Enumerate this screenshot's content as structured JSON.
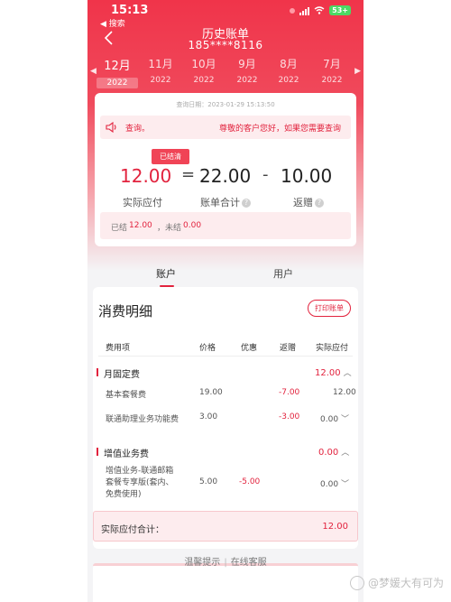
{
  "status_bar": {
    "time": "15:13",
    "back_app": "◀ 搜索",
    "battery": "53+"
  },
  "header": {
    "title": "历史账单",
    "phone": "185****8116"
  },
  "months": [
    {
      "month": "12月",
      "year": "2022",
      "active": true
    },
    {
      "month": "11月",
      "year": "2022"
    },
    {
      "month": "10月",
      "year": "2022"
    },
    {
      "month": "9月",
      "year": "2022"
    },
    {
      "month": "8月",
      "year": "2022"
    },
    {
      "month": "7月",
      "year": "2022"
    }
  ],
  "summary": {
    "query_date": "查询日期：2023-01-29 15:13:50",
    "notice_left": "查询。",
    "notice_right": "尊敬的客户您好，如果您需要查询",
    "status_tag": "已结清",
    "payable": "12.00",
    "op_eq": "=",
    "total": "22.00",
    "op_minus": "-",
    "rebate": "10.00",
    "payable_label": "实际应付",
    "total_label": "账单合计",
    "rebate_label": "返赠",
    "settled_prefix": "已结",
    "settled_value": "12.00",
    "unsettled_prefix": "，未结",
    "unsettled_value": "0.00"
  },
  "tabs": [
    {
      "label": "账户",
      "active": true
    },
    {
      "label": "用户"
    }
  ],
  "detail": {
    "title": "消费明细",
    "print_button": "打印账单",
    "columns": [
      "费用项",
      "价格",
      "优惠",
      "返赠",
      "实际应付"
    ],
    "groups": [
      {
        "name": "月固定费",
        "amount": "12.00",
        "rows": [
          {
            "item": "基本套餐费",
            "price": "19.00",
            "discount": "",
            "rebate": "-7.00",
            "actual": "12.00"
          },
          {
            "item": "联通助理业务功能费",
            "price": "3.00",
            "discount": "",
            "rebate": "-3.00",
            "actual": "0.00"
          }
        ]
      },
      {
        "name": "增值业务费",
        "amount": "0.00",
        "rows": [
          {
            "item": "增值业务-联通邮箱套餐专享版(套内、免费使用)",
            "item_lines": [
              "增值业务-联通邮箱",
              "套餐专享版(套内、",
              "免费使用)"
            ],
            "price": "5.00",
            "discount": "-5.00",
            "rebate": "",
            "actual": "0.00"
          }
        ]
      }
    ],
    "total_label": "实际应付合计：",
    "total_value": "12.00"
  },
  "footer": {
    "tip": "温馨提示",
    "service": "在线客服"
  },
  "watermark": "@梦媛大有可为",
  "colors": {
    "accent": "#e2233e",
    "hero": "#f0344a",
    "tint": "#fdecee"
  }
}
